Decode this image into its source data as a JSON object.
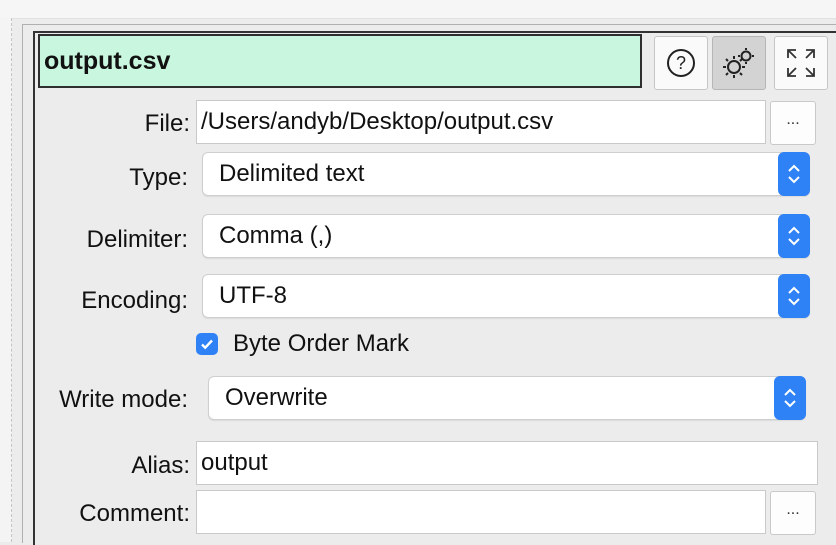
{
  "node": {
    "title": "output.csv",
    "help_icon": "help-icon",
    "settings_icon": "gear-icon",
    "expand_icon": "expand-icon"
  },
  "form": {
    "file": {
      "label": "File:",
      "value": "/Users/andyb/Desktop/output.csv",
      "browse_label": "..."
    },
    "type": {
      "label": "Type:",
      "value": "Delimited text"
    },
    "delimiter": {
      "label": "Delimiter:",
      "value": "Comma (,)"
    },
    "encoding": {
      "label": "Encoding:",
      "value": "UTF-8"
    },
    "bom": {
      "label": "Byte Order Mark",
      "checked": true
    },
    "write_mode": {
      "label": "Write mode:",
      "value": "Overwrite"
    },
    "alias": {
      "label": "Alias:",
      "value": "output"
    },
    "comment": {
      "label": "Comment:",
      "value": "",
      "browse_label": "..."
    }
  },
  "colors": {
    "title_bg": "#c9f6df",
    "accent": "#2f82f6"
  }
}
